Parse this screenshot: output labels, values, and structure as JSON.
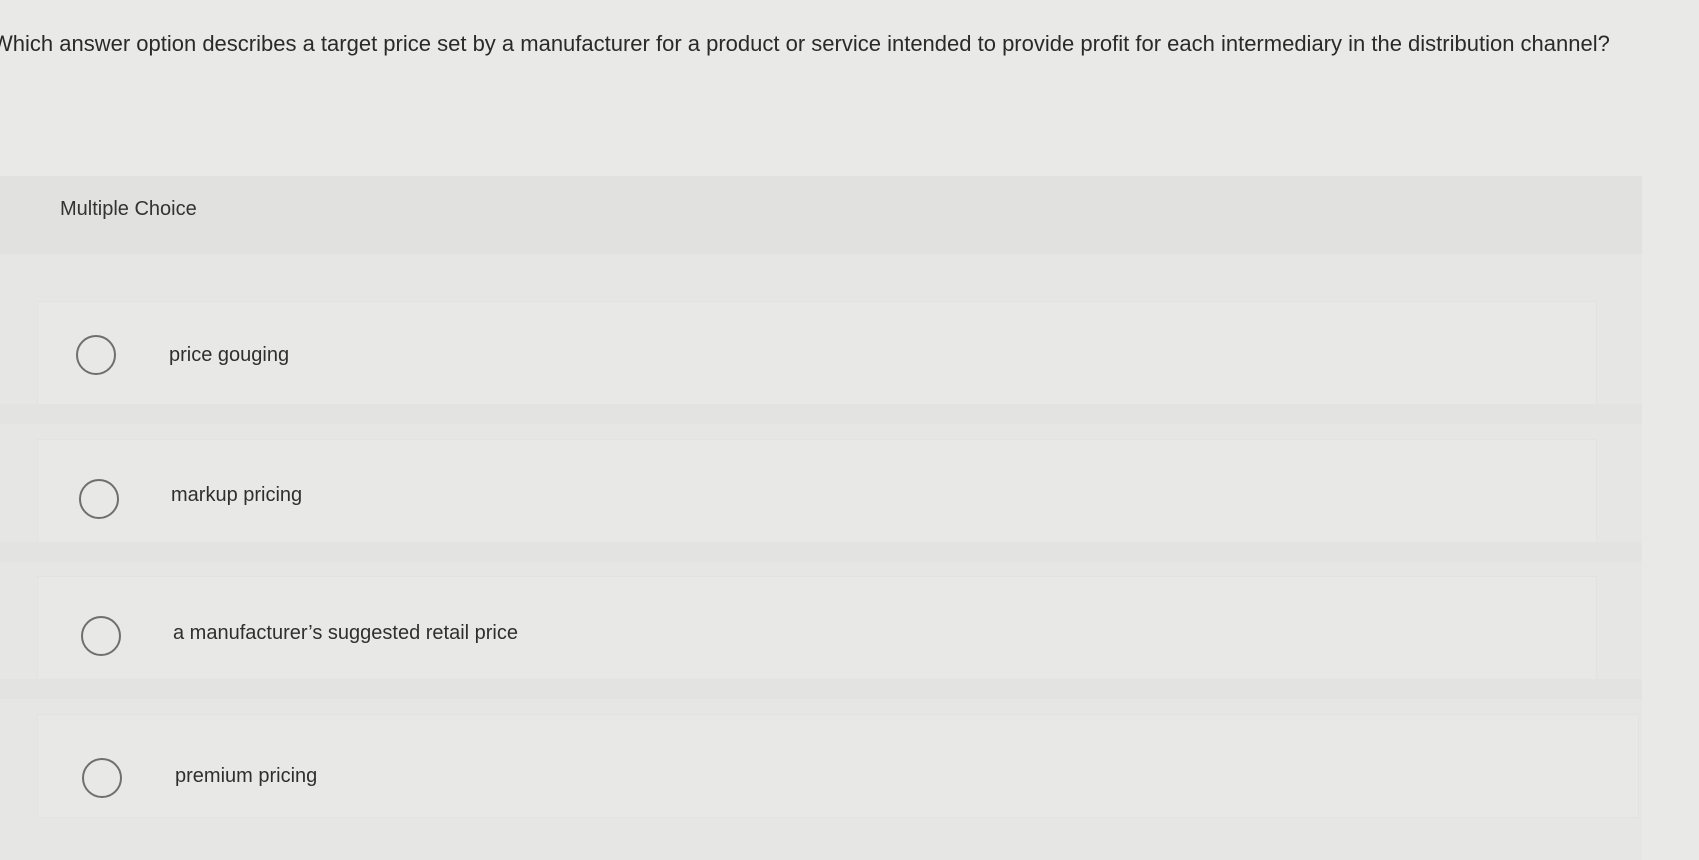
{
  "question": {
    "text": "Which answer option describes a target price set by a manufacturer for a product or service intended to provide profit for each intermediary in the distribution channel?"
  },
  "section": {
    "label": "Multiple Choice"
  },
  "options": [
    {
      "label": "price gouging",
      "selected": false
    },
    {
      "label": "markup pricing",
      "selected": false
    },
    {
      "label": "a manufacturer’s suggested retail price",
      "selected": false
    },
    {
      "label": "premium pricing",
      "selected": false
    }
  ]
}
